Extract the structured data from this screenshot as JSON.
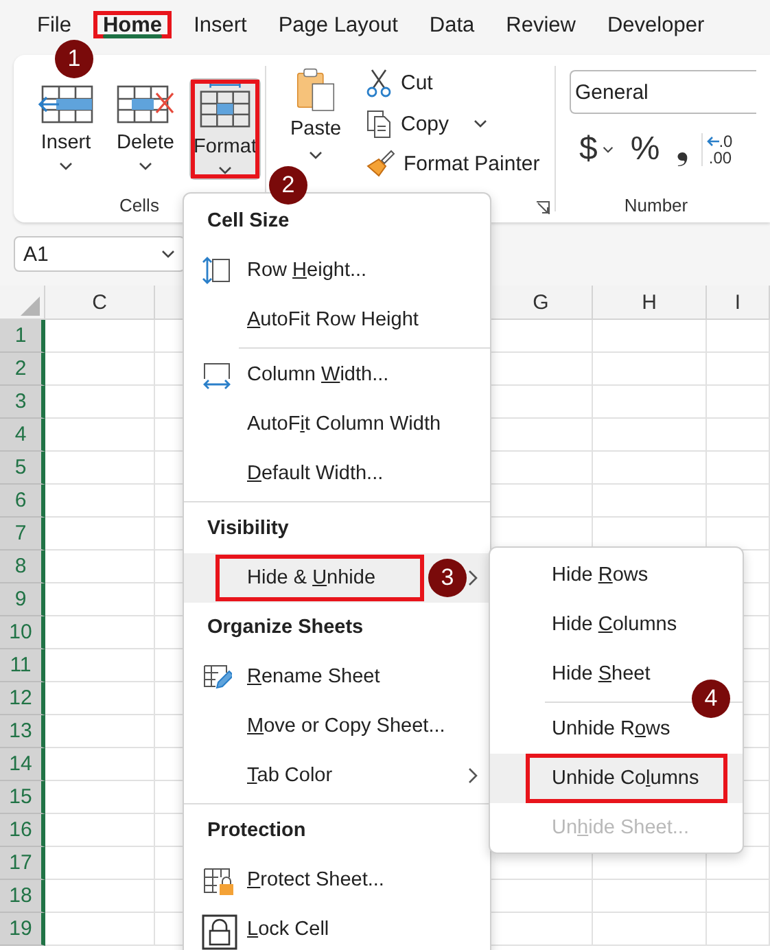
{
  "ribbon_tabs": [
    {
      "label": "File",
      "selected": false,
      "highlighted": false
    },
    {
      "label": "Home",
      "selected": true,
      "highlighted": true,
      "callout": "1"
    },
    {
      "label": "Insert",
      "selected": false,
      "highlighted": false
    },
    {
      "label": "Page Layout",
      "selected": false,
      "highlighted": false
    },
    {
      "label": "Data",
      "selected": false,
      "highlighted": false
    },
    {
      "label": "Review",
      "selected": false,
      "highlighted": false
    },
    {
      "label": "Developer",
      "selected": false,
      "highlighted": false
    }
  ],
  "ribbon": {
    "cells_group": {
      "label": "Cells",
      "buttons": [
        {
          "kind": "insert",
          "label": "Insert",
          "pressed": false,
          "highlighted": false
        },
        {
          "kind": "delete",
          "label": "Delete",
          "pressed": false,
          "highlighted": false
        },
        {
          "kind": "format",
          "label": "Format",
          "pressed": true,
          "highlighted": true,
          "callout": "2"
        }
      ]
    },
    "clipboard_group": {
      "paste": {
        "label": "Paste"
      },
      "commands": [
        {
          "kind": "cut",
          "label": "Cut",
          "dropdown": false
        },
        {
          "kind": "copy",
          "label": "Copy",
          "dropdown": true
        },
        {
          "kind": "format-painter",
          "label": "Format Painter",
          "dropdown": false
        }
      ]
    },
    "number_group": {
      "label": "Number",
      "format": "General",
      "symbols": [
        {
          "text": "$",
          "dropdown": true
        },
        {
          "text": "%",
          "dropdown": false
        },
        {
          "text": "❟",
          "dropdown": false
        }
      ],
      "decimal": {
        "top": ".0",
        "bottom": ".00"
      }
    }
  },
  "name_box": {
    "value": "A1"
  },
  "sheet": {
    "columns": [
      "C",
      "G",
      "H",
      "I"
    ],
    "rows": [
      "1",
      "2",
      "3",
      "4",
      "5",
      "6",
      "7",
      "8",
      "9",
      "10",
      "11",
      "12",
      "13",
      "14",
      "15",
      "16",
      "17",
      "18",
      "19"
    ]
  },
  "format_menu": {
    "entries": [
      {
        "kind": "header",
        "label": "Cell Size"
      },
      {
        "kind": "item",
        "label": {
          "before": "Row ",
          "key": "H",
          "after": "eight..."
        },
        "selected": false,
        "highlighted": false,
        "submenu": false,
        "disabled": false
      },
      {
        "kind": "item",
        "label": {
          "key": "A",
          "after": "utoFit Row Height"
        },
        "selected": false,
        "highlighted": false,
        "submenu": false,
        "disabled": false
      },
      {
        "kind": "separator",
        "indented": true
      },
      {
        "kind": "item",
        "label": {
          "before": "Column ",
          "key": "W",
          "after": "idth..."
        },
        "selected": false,
        "highlighted": false,
        "submenu": false,
        "disabled": false
      },
      {
        "kind": "item",
        "label": {
          "before": "AutoF",
          "key": "i",
          "after": "t Column Width"
        },
        "selected": false,
        "highlighted": false,
        "submenu": false,
        "disabled": false
      },
      {
        "kind": "item",
        "label": {
          "key": "D",
          "after": "efault Width..."
        },
        "selected": false,
        "highlighted": false,
        "submenu": false,
        "disabled": false
      },
      {
        "kind": "separator",
        "indented": false
      },
      {
        "kind": "header",
        "label": "Visibility"
      },
      {
        "kind": "item",
        "label": {
          "before": "Hide & ",
          "key": "U",
          "after": "nhide"
        },
        "selected": true,
        "highlighted": true,
        "submenu": true,
        "disabled": false,
        "callout": "3"
      },
      {
        "kind": "header",
        "label": "Organize Sheets"
      },
      {
        "kind": "item",
        "label": {
          "key": "R",
          "after": "ename Sheet"
        },
        "selected": false,
        "highlighted": false,
        "submenu": false,
        "disabled": false
      },
      {
        "kind": "item",
        "label": {
          "key": "M",
          "after": "ove or Copy Sheet..."
        },
        "selected": false,
        "highlighted": false,
        "submenu": false,
        "disabled": false
      },
      {
        "kind": "item",
        "label": {
          "key": "T",
          "after": "ab Color"
        },
        "selected": false,
        "highlighted": false,
        "submenu": true,
        "disabled": false
      },
      {
        "kind": "separator",
        "indented": false
      },
      {
        "kind": "header",
        "label": "Protection"
      },
      {
        "kind": "item",
        "label": {
          "key": "P",
          "after": "rotect Sheet..."
        },
        "selected": false,
        "highlighted": false,
        "submenu": false,
        "disabled": false
      },
      {
        "kind": "item",
        "label": {
          "key": "L",
          "after": "ock Cell"
        },
        "selected": false,
        "highlighted": false,
        "submenu": false,
        "disabled": false
      }
    ]
  },
  "hide_unhide_submenu": {
    "entries": [
      {
        "kind": "item",
        "label": {
          "before": "Hide ",
          "key": "R",
          "after": "ows"
        },
        "selected": false,
        "highlighted": false,
        "submenu": false,
        "disabled": false
      },
      {
        "kind": "item",
        "label": {
          "before": "Hide ",
          "key": "C",
          "after": "olumns"
        },
        "selected": false,
        "highlighted": false,
        "submenu": false,
        "disabled": false
      },
      {
        "kind": "item",
        "label": {
          "before": "Hide ",
          "key": "S",
          "after": "heet"
        },
        "selected": false,
        "highlighted": false,
        "submenu": false,
        "disabled": false
      },
      {
        "kind": "separator",
        "indented": true
      },
      {
        "kind": "item",
        "label": {
          "before": "Unhide R",
          "key": "o",
          "after": "ws"
        },
        "selected": false,
        "highlighted": false,
        "submenu": false,
        "disabled": false,
        "callout": "4"
      },
      {
        "kind": "item",
        "label": {
          "before": "Unhide Co",
          "key": "l",
          "after": "umns"
        },
        "selected": true,
        "highlighted": true,
        "submenu": false,
        "disabled": false
      },
      {
        "kind": "item",
        "label": {
          "before": "Un",
          "key": "h",
          "after": "ide Sheet..."
        },
        "selected": false,
        "highlighted": false,
        "submenu": false,
        "disabled": true
      }
    ]
  }
}
